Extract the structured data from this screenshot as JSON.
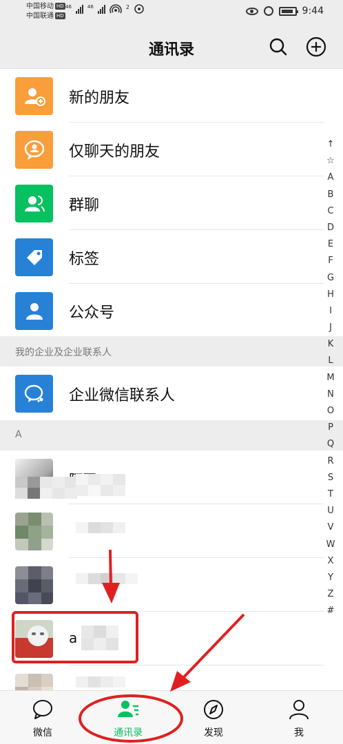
{
  "status_bar": {
    "carrier1": "中国移动",
    "carrier2": "中国联通",
    "hd_badge": "HD",
    "net1": "46",
    "net2": "46",
    "wifi_count": "2",
    "time": "9:44"
  },
  "header": {
    "title": "通讯录"
  },
  "menu": [
    {
      "label": "新的朋友",
      "icon": "add-friend-icon",
      "color": "#fa9d3b"
    },
    {
      "label": "仅聊天的朋友",
      "icon": "chat-only-icon",
      "color": "#fa9d3b"
    },
    {
      "label": "群聊",
      "icon": "group-chat-icon",
      "color": "#07c160"
    },
    {
      "label": "标签",
      "icon": "tag-icon",
      "color": "#2782d7"
    },
    {
      "label": "公众号",
      "icon": "official-account-icon",
      "color": "#2782d7"
    }
  ],
  "enterprise": {
    "section_title": "我的企业及企业联系人",
    "item_label": "企业微信联系人",
    "color": "#2782d7"
  },
  "contacts": {
    "section_letter": "A",
    "items": [
      {
        "name": "阿哥"
      },
      {
        "name": ""
      },
      {
        "name": ""
      },
      {
        "name": "a"
      },
      {
        "name": ""
      }
    ]
  },
  "alphabet": [
    "↑",
    "☆",
    "A",
    "B",
    "C",
    "D",
    "E",
    "F",
    "G",
    "H",
    "I",
    "J",
    "K",
    "L",
    "M",
    "N",
    "O",
    "P",
    "Q",
    "R",
    "S",
    "T",
    "U",
    "V",
    "W",
    "X",
    "Y",
    "Z",
    "#"
  ],
  "tabs": [
    {
      "label": "微信",
      "icon": "chat-bubble-icon"
    },
    {
      "label": "通讯录",
      "icon": "contacts-icon",
      "active": true
    },
    {
      "label": "发现",
      "icon": "compass-icon"
    },
    {
      "label": "我",
      "icon": "person-icon"
    }
  ],
  "colors": {
    "brand_green": "#07c160",
    "orange": "#fa9d3b",
    "blue": "#2782d7",
    "annotation_red": "#e02020"
  }
}
